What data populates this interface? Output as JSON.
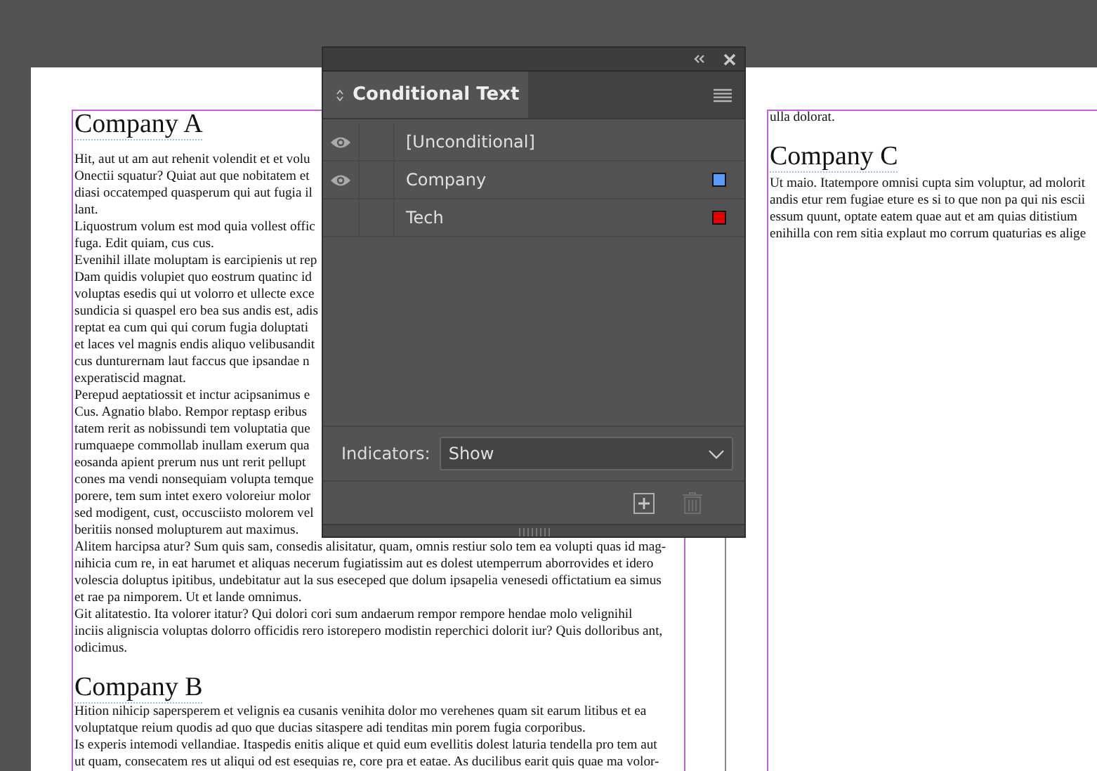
{
  "document": {
    "left_column": {
      "sections": [
        {
          "heading": "Company A",
          "lines": [
            "Hit, aut ut am aut rehenit volendit et et volu",
            "Onectii squatur? Quiat aut que nobitatem et",
            "diasi occatemped quasperum qui aut fugia il",
            "lant.",
            "Liquostrum volum est mod quia vollest offic",
            "fuga. Edit quiam, cus cus.",
            "Evenihil illate moluptam is earcipienis ut rep",
            "Dam quidis volupiet quo eostrum quatinc id",
            "voluptas esedis qui ut volorro et ullecte exce",
            "sundicia si quaspel ero bea sus andis est, adis",
            "reptat ea cum qui qui corum fugia doluptati",
            "et laces vel magnis endis aliquo velibusandit",
            "cus dunturernam laut faccus que ipsandae n",
            "experatiscid magnat.",
            "Perepud aeptatiossit et inctur acipsanimus e",
            "Cus. Agnatio blabo. Rempor reptasp eribus",
            "tatem rerit as nobissundi tem voluptatia que",
            "rumquaepe commollab inullam exerum qua",
            "eosanda apient prerum nus unt rerit pellupt",
            "cones ma vendi nonsequiam volupta temque",
            "porere, tem sum intet exero voloreiur molor",
            "sed modigent, cust, occusciisto molorem vel",
            "beritiis nonsed molupturem aut maximus.",
            "Alitem harcipsa atur? Sum quis sam, consedis alisitatur, quam, omnis restiur solo tem ea volupti quas id mag-",
            "nihicia cum re, in eat harumet et aliquas necerum fugiatissim aut es dolest utemperrum aborrovides et idero",
            "volescia doluptus ipitibus, undebitatur aut la sus eseceped que dolum ipsapelia venesedi offictatium ea simus",
            "et rae pa nimporem. Ut et lande omnimus.",
            "Git alitatestio. Ita volorer itatur? Qui dolori cori sum andaerum rempor rempore hendae molo velignihil",
            "inciis aligniscia voluptas dolorro officidis rero istorepero modistin reperchici dolorit iur? Quis dolloribus ant,",
            "odicimus."
          ]
        },
        {
          "heading": "Company B",
          "lines": [
            "Hition nihicip sapersperem et velignis ea cusanis venihita dolor mo verehenes quam sit earum litibus et ea",
            "voluptatque reium quodis ad quo que ducias sitaspere adi tenditas min porem fugia corporibus.",
            "Is experis intemodi vellandiae. Itaspedis enitis alique et quid eum evellitis dolest laturia tendella pro tem aut",
            "ut quam, consecatem res ut aliqui od est esequias re, core pra et eatae. As ducilibus earit quis quae ma volor-"
          ]
        }
      ]
    },
    "right_column": {
      "lines": [
        "ulla dolorat."
      ],
      "sections": [
        {
          "heading": "Company C",
          "lines": [
            "Ut maio. Itatempore omnisi cupta sim voluptur, ad molorit",
            "andis etur rem fugiae eture es si to que non pa qui nis escii",
            "essum quunt, optate eatem quae aut et am quias ditistium",
            "enihilla con rem sitia explaut mo corrum quaturias es alige"
          ]
        }
      ]
    }
  },
  "panel": {
    "title": "Conditional Text",
    "conditions": [
      {
        "name": "[Unconditional]",
        "visible": true
      },
      {
        "name": "Company",
        "visible": true,
        "color": "#5b9bf6"
      },
      {
        "name": "Tech",
        "visible": false,
        "color": "#e50000"
      }
    ],
    "indicators": {
      "label": "Indicators:",
      "value": "Show"
    }
  }
}
